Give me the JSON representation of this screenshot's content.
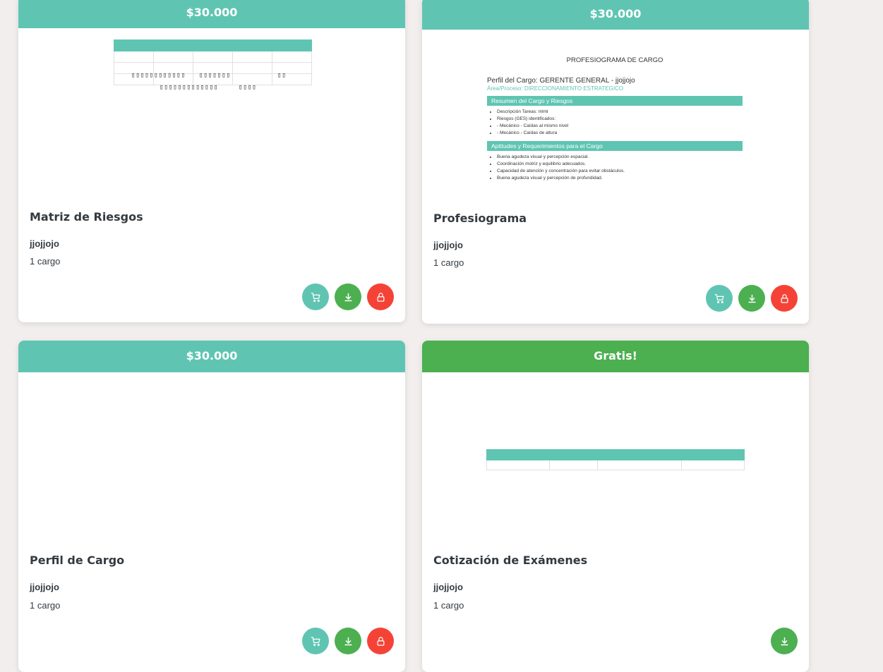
{
  "colors": {
    "teal": "#5fc5b2",
    "green": "#4caf50",
    "red": "#f44336",
    "background": "#f1eeed"
  },
  "cards": [
    {
      "price": "$30.000",
      "title": "Matriz de Riesgos",
      "company": "jjojjojo",
      "count": "1 cargo",
      "preview": {
        "row_glyphs_1": [
          "▯▯▯▯▯▯▯▯▯▯▯▯",
          "▯▯▯▯▯▯▯",
          "▯▯"
        ],
        "row_glyphs_2": [
          "▯▯▯▯▯▯▯▯▯▯▯▯▯",
          "▯▯▯▯"
        ]
      }
    },
    {
      "price": "$30.000",
      "title": "Profesiograma",
      "company": "jjojjojo",
      "count": "1 cargo",
      "preview": {
        "heading": "PROFESIOGRAMA DE CARGO",
        "perfil": "Perfil del Cargo: GERENTE GENERAL - jjojjojo",
        "area": "Área/Proceso: DIRECCIONAMIENTO ESTRATEGICO",
        "section1": "Resumen del Cargo y Riesgos",
        "section1_items": [
          "Descripción Tareas: mlml",
          "Riesgos (GES) identificados:",
          "- Mecánico - Caídas al mismo nivel",
          "- Mecánico - Caídas de altura"
        ],
        "section2": "Aptitudes y Requerimientos para el Cargo",
        "section2_items": [
          "Buena agudeza visual y percepción espacial.",
          "Coordinación motriz y equilibrio adecuados.",
          "Capacidad de atención y concentración para evitar obstáculos.",
          "Buena agudeza visual y percepción de profundidad."
        ]
      }
    },
    {
      "price": "$30.000",
      "title": "Perfil de Cargo",
      "company": "jjojjojo",
      "count": "1 cargo"
    },
    {
      "price": "Gratis!",
      "title": "Cotización de Exámenes",
      "company": "jjojjojo",
      "count": "1 cargo"
    }
  ],
  "icons": {
    "cart": "cart-icon",
    "download": "download-icon",
    "lock": "lock-icon"
  }
}
